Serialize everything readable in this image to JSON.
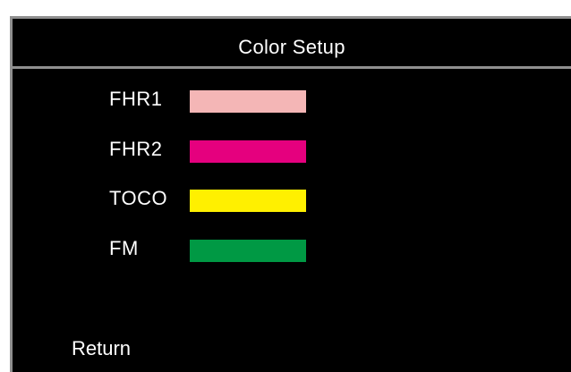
{
  "window": {
    "title": "Color Setup"
  },
  "channels": [
    {
      "label": "FHR1",
      "color": "#f4b6b6"
    },
    {
      "label": "FHR2",
      "color": "#e5007e"
    },
    {
      "label": "TOCO",
      "color": "#fff000"
    },
    {
      "label": "FM",
      "color": "#009944"
    }
  ],
  "footer": {
    "return_label": "Return"
  }
}
